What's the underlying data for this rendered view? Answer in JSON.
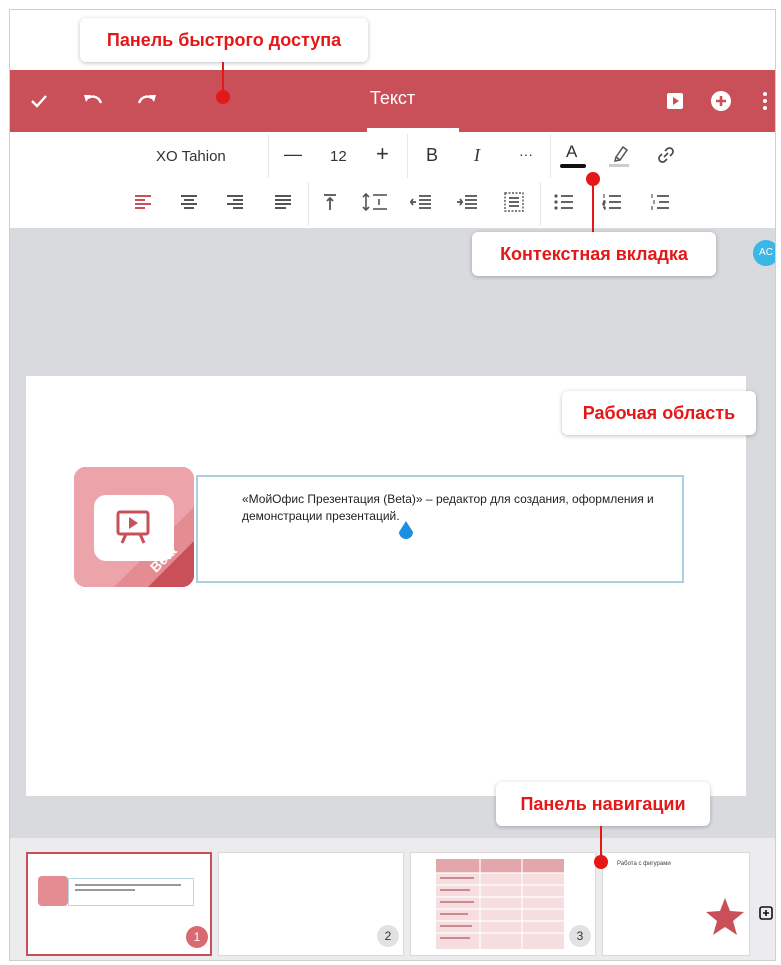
{
  "callouts": {
    "quick_access": "Панель быстрого доступа",
    "context_tab": "Контекстная вкладка",
    "workspace": "Рабочая область",
    "navigation": "Панель навигации"
  },
  "appbar": {
    "title": "Текст",
    "icons": [
      "check-icon",
      "undo-icon",
      "redo-icon",
      "play-icon",
      "add-circle-icon",
      "more-vert-icon"
    ]
  },
  "format_toolbar": {
    "font_name": "XO Tahion",
    "decrease": "—",
    "font_size": "12",
    "increase": "+",
    "bold": "B",
    "italic": "I",
    "more": "···",
    "font_color_letter": "A",
    "highlight_icon": "highlighter-icon",
    "link_icon": "link-icon"
  },
  "paragraph_toolbar": {
    "icons": [
      "align-left-icon",
      "align-center-icon",
      "align-right-icon",
      "align-justify-icon",
      "align-top-icon",
      "line-spacing-icon",
      "outdent-icon",
      "indent-icon",
      "vertical-align-icon",
      "bulleted-list-icon",
      "numbered-list-icon",
      "multilevel-list-icon"
    ]
  },
  "avatar": {
    "initials": "AC"
  },
  "slide": {
    "logo_badge": "Beta",
    "text": "«МойОфис Презентация (Beta)» – редактор для создания, оформления и демонстрации презентаций."
  },
  "nav": {
    "thumbs": [
      {
        "number": "1",
        "active": true
      },
      {
        "number": "2",
        "active": false
      },
      {
        "number": "3",
        "active": false
      },
      {
        "number": "",
        "title": "Работа с фигурами",
        "active": false
      }
    ],
    "add_slide_icon": "add-slide-icon"
  },
  "colors": {
    "accent": "#c94f59",
    "callout_text": "#e41818",
    "cursor": "#1e8fe0"
  }
}
